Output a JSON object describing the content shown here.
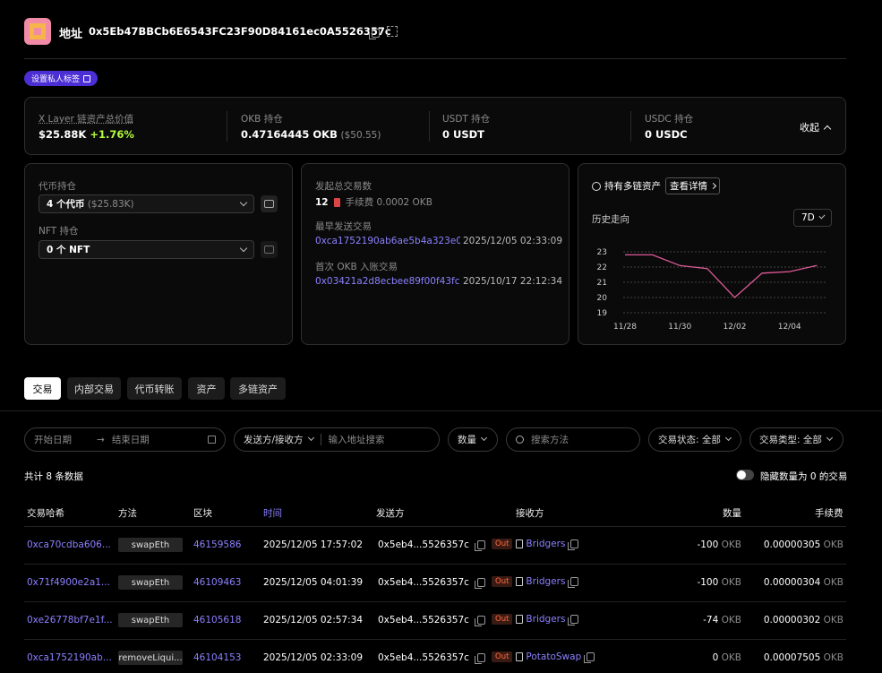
{
  "header": {
    "title": "地址",
    "address": "0x5Eb47BBCb6E6543FC23F90D84161ec0A5526357c",
    "tag_button": "设置私人标签"
  },
  "summary": {
    "total_label": "X Layer 链资产总价值",
    "total_value": "$25.88K",
    "total_change": "+1.76%",
    "okb_label": "OKB 持仓",
    "okb_value": "0.47164445 OKB",
    "okb_usd": "($50.55)",
    "usdt_label": "USDT 持仓",
    "usdt_value": "0 USDT",
    "usdc_label": "USDC 持仓",
    "usdc_value": "0 USDC",
    "collapse": "收起"
  },
  "holdings": {
    "token_label": "代币持仓",
    "token_count": "4 个代币",
    "token_usd": "($25.83K)",
    "nft_label": "NFT 持仓",
    "nft_count": "0 个 NFT"
  },
  "tx_stats": {
    "total_label": "发起总交易数",
    "total_count": "12",
    "fee_text": "手续费 0.0002 OKB",
    "earliest_label": "最早发送交易",
    "earliest_hash": "0xca1752190ab6ae5b4a323e0...",
    "earliest_time": "2025/12/05 02:33:09",
    "first_in_label": "首次 OKB 入账交易",
    "first_in_hash": "0x03421a2d8ecbee89f00f43fc...",
    "first_in_time": "2025/10/17 22:12:34"
  },
  "multichain": {
    "label": "持有多链资产",
    "detail_button": "查看详情",
    "history_label": "历史走向",
    "range": "7D"
  },
  "chart_data": {
    "type": "line",
    "x": [
      "11/28",
      "11/29",
      "11/30",
      "12/01",
      "12/02",
      "12/03",
      "12/04",
      "12/05"
    ],
    "xticks": [
      "11/28",
      "11/30",
      "12/02",
      "12/04"
    ],
    "values": [
      22.8,
      22.8,
      22.1,
      21.9,
      20.0,
      21.6,
      21.7,
      22.1
    ],
    "yticks": [
      "23",
      "22",
      "21",
      "20",
      "19"
    ],
    "ylim": [
      19,
      23
    ],
    "color": "#e05a9a",
    "grid": true
  },
  "tabs": [
    "交易",
    "内部交易",
    "代币转账",
    "资产",
    "多链资产"
  ],
  "filters": {
    "start_date": "开始日期",
    "end_date": "结束日期",
    "direction": "发送方/接收方",
    "address_placeholder": "输入地址搜索",
    "amount": "数量",
    "method_placeholder": "搜索方法",
    "status": "交易状态: 全部",
    "type": "交易类型: 全部"
  },
  "table_meta": {
    "count": "共计 8 条数据",
    "hide_zero": "隐藏数量为 0 的交易"
  },
  "columns": [
    "交易哈希",
    "方法",
    "区块",
    "时间",
    "发送方",
    "接收方",
    "数量",
    "手续费"
  ],
  "rows": [
    {
      "hash": "0xca70cdba606...",
      "method": "swapEth",
      "block": "46159586",
      "time": "2025/12/05 17:57:02",
      "from": "0x5eb4...5526357c",
      "dir": "Out",
      "to": "Bridgers",
      "amount": "-100",
      "unit": "OKB",
      "fee": "0.00000305",
      "fee_unit": "OKB"
    },
    {
      "hash": "0x71f4900e2a1...",
      "method": "swapEth",
      "block": "46109463",
      "time": "2025/12/05 04:01:39",
      "from": "0x5eb4...5526357c",
      "dir": "Out",
      "to": "Bridgers",
      "amount": "-100",
      "unit": "OKB",
      "fee": "0.00000304",
      "fee_unit": "OKB"
    },
    {
      "hash": "0xe26778bf7e1f...",
      "method": "swapEth",
      "block": "46105618",
      "time": "2025/12/05 02:57:34",
      "from": "0x5eb4...5526357c",
      "dir": "Out",
      "to": "Bridgers",
      "amount": "-74",
      "unit": "OKB",
      "fee": "0.00000302",
      "fee_unit": "OKB"
    },
    {
      "hash": "0xca1752190ab...",
      "method": "removeLiqui...",
      "block": "46104153",
      "time": "2025/12/05 02:33:09",
      "from": "0x5eb4...5526357c",
      "dir": "Out",
      "to": "PotatoSwap",
      "amount": "0",
      "unit": "OKB",
      "fee": "0.00007505",
      "fee_unit": "OKB"
    }
  ]
}
